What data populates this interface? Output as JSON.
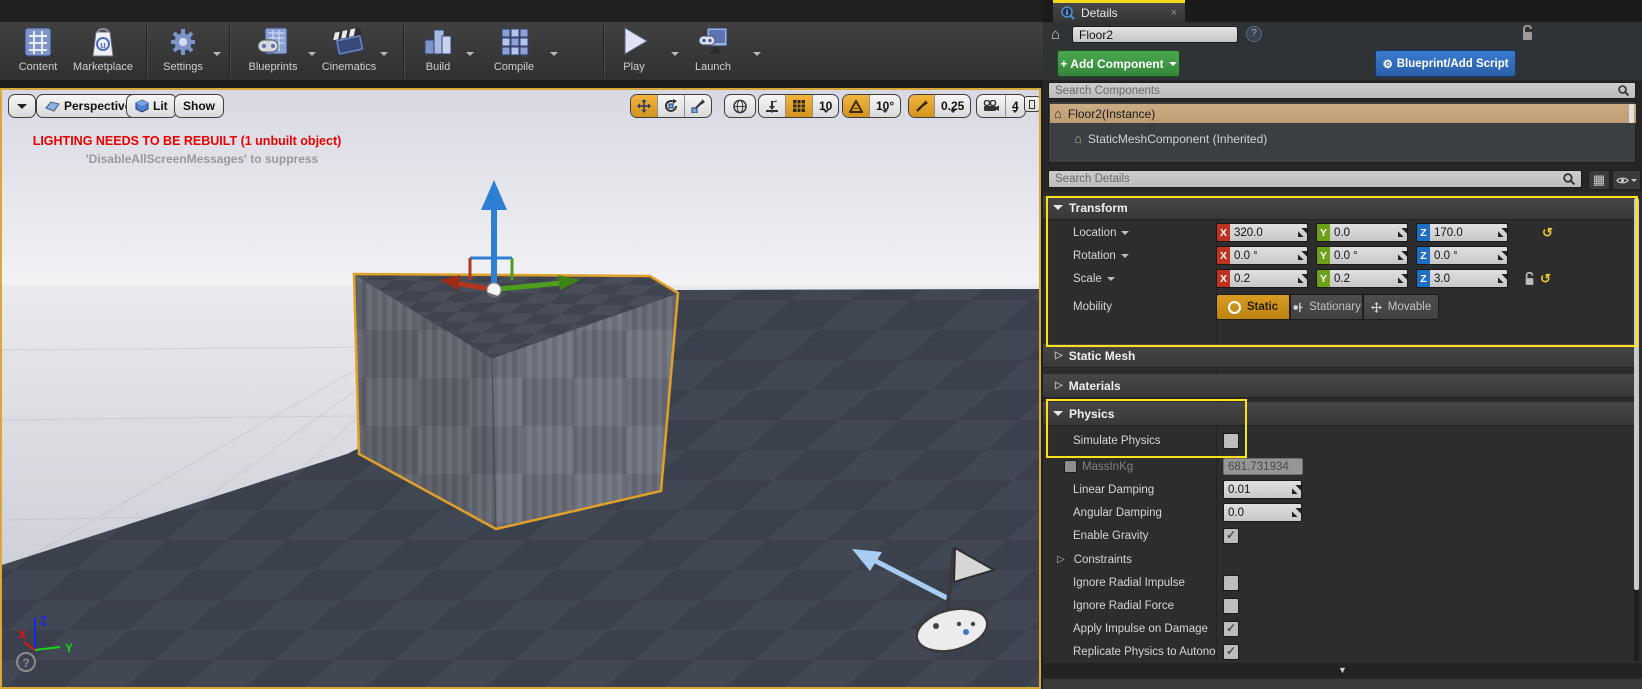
{
  "main_toolbar": {
    "items": [
      {
        "label": "Content"
      },
      {
        "label": "Marketplace"
      },
      {
        "label": "Settings"
      },
      {
        "label": "Blueprints"
      },
      {
        "label": "Cinematics"
      },
      {
        "label": "Build"
      },
      {
        "label": "Compile"
      },
      {
        "label": "Play"
      },
      {
        "label": "Launch"
      }
    ]
  },
  "viewport": {
    "toolbar": {
      "perspective_label": "Perspective",
      "lit_label": "Lit",
      "show_label": "Show",
      "grid_snap_value": "10",
      "rotation_snap_value": "10°",
      "scale_snap_value": "0.25",
      "camera_speed_value": "4"
    },
    "warning_line1": "LIGHTING NEEDS TO BE REBUILT (1 unbuilt object)",
    "warning_line2": "'DisableAllScreenMessages' to suppress",
    "axis_labels": {
      "x": "X",
      "y": "Y",
      "z": "Z"
    },
    "help_glyph": "?"
  },
  "details": {
    "tab_title": "Details",
    "close_glyph": "×",
    "actor_name_value": "Floor2",
    "help_glyph": "?",
    "add_component_label": "+ Add Component",
    "blueprint_gear_glyph": "⚙",
    "blueprint_add_script_label": "Blueprint/Add Script",
    "search_components_placeholder": "Search Components",
    "component_tree": [
      {
        "label": "Floor2(Instance)"
      },
      {
        "label": "StaticMeshComponent (Inherited)"
      }
    ],
    "search_details_placeholder": "Search Details",
    "axes": {
      "x": "X",
      "y": "Y",
      "z": "Z"
    },
    "transform": {
      "header": "Transform",
      "location": {
        "label": "Location",
        "x": "320.0",
        "y": "0.0",
        "z": "170.0"
      },
      "rotation": {
        "label": "Rotation",
        "x": "0.0 °",
        "y": "0.0 °",
        "z": "0.0 °"
      },
      "scale": {
        "label": "Scale",
        "x": "0.2",
        "y": "0.2",
        "z": "3.0"
      },
      "mobility": {
        "label": "Mobility",
        "options": [
          "Static",
          "Stationary",
          "Movable"
        ],
        "selected": "Static"
      },
      "reset_glyph": "↺"
    },
    "sections": {
      "static_mesh": "Static Mesh",
      "materials": "Materials",
      "physics": "Physics"
    },
    "physics": {
      "simulate_physics_label": "Simulate Physics",
      "mass_label": "MassInKg",
      "mass_value": "681.731934",
      "linear_damping_label": "Linear Damping",
      "linear_damping_value": "0.01",
      "angular_damping_label": "Angular Damping",
      "angular_damping_value": "0.0",
      "enable_gravity_label": "Enable Gravity",
      "constraints_label": "Constraints",
      "ignore_radial_impulse_label": "Ignore Radial Impulse",
      "ignore_radial_force_label": "Ignore Radial Force",
      "apply_impulse_on_damage_label": "Apply Impulse on Damage",
      "replicate_physics_label": "Replicate Physics to Autonomous P"
    },
    "checkbox_states": {
      "simulate_physics": false,
      "mass_in_kg": false,
      "enable_gravity": true,
      "ignore_radial_impulse": false,
      "ignore_radial_force": false,
      "apply_impulse_on_damage": true,
      "replicate_physics": true
    },
    "scroll_more_glyph": "▼"
  },
  "colors": {
    "highlight_yellow": "#ffe11a",
    "selection_orange": "#e1a129",
    "mobility_active": "#cf9018",
    "axis_x": "#b3361f",
    "axis_y": "#4f9d1d",
    "axis_z": "#2e7fd4",
    "add_component_green": "#3f9b43",
    "blueprint_blue": "#2a6bbf",
    "selected_row_tan": "#c5a47c",
    "warning_red": "#e90000"
  }
}
